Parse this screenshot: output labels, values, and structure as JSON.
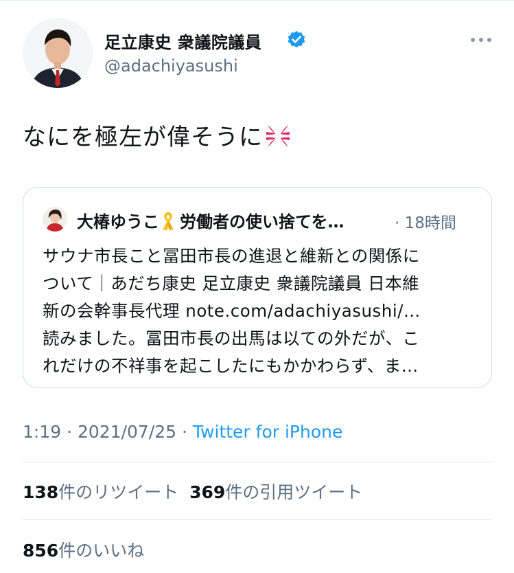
{
  "author": {
    "display_name": "足立康史 衆議院議員",
    "handle": "@adachiyasushi",
    "verified": true
  },
  "tweet": {
    "text": "なにを極左が偉そうに",
    "emoji": "anger-icon"
  },
  "quoted_tweet": {
    "display_name": "大椿ゆうこ",
    "display_name_rest": "労働者の使い捨てを…",
    "ribbon": "yellow-ribbon-icon",
    "time": "· 18時間",
    "lines": [
      "サウナ市長こと冨田市長の進退と維新との関係に",
      "ついて｜あだち康史 足立康史 衆議院議員 日本維",
      "新の会幹事長代理  note.com/adachiyasushi/…",
      "読みました。冨田市長の出馬は以ての外だが、こ",
      "れだけの不祥事を起こしたにもかかわらず、ま…"
    ]
  },
  "meta": {
    "time": "1:19",
    "dot1": " · ",
    "date": "2021/07/25",
    "dot2": " · ",
    "source": "Twitter for iPhone"
  },
  "stats": {
    "retweets_count": "138",
    "retweets_label": "件のリツイート",
    "quotes_count": "369",
    "quotes_label": "件の引用ツイート",
    "likes_count": "856",
    "likes_label": "件のいいね"
  },
  "colors": {
    "link": "#1d9bf0",
    "secondary_text": "#5b7083",
    "border": "#cfd9de"
  }
}
